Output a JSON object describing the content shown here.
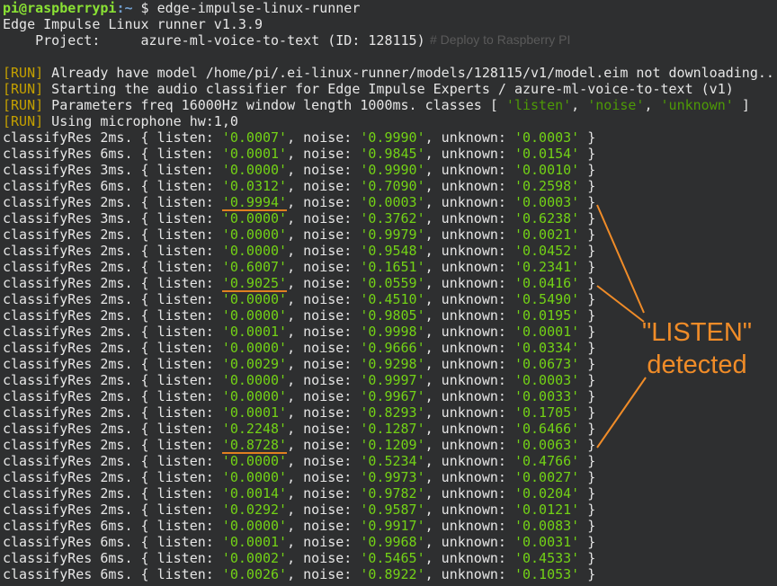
{
  "background_color": "#2e2f30",
  "accent_color": "#f08c28",
  "prompt": {
    "user_host": "pi@raspberrypi",
    "path": ":~",
    "symbol": " $ ",
    "command": "edge-impulse-linux-runner"
  },
  "header_lines": [
    "Edge Impulse Linux runner v1.3.9",
    "    Project:     azure-ml-voice-to-text (ID: 128115)"
  ],
  "ghost_text": {
    "deploy_comment": "# Deploy to Raspberry PI"
  },
  "run_lines": [
    {
      "tag": "[RUN]",
      "text": " Already have model /home/pi/.ei-linux-runner/models/128115/v1/model.eim not downloading..."
    },
    {
      "tag": "[RUN]",
      "text": " Starting the audio classifier for Edge Impulse Experts / azure-ml-voice-to-text (v1)"
    },
    {
      "tag": "[RUN]",
      "text": " Using microphone hw:1,0"
    }
  ],
  "params_line": {
    "tag": "[RUN]",
    "prefix": " Parameters freq 16000Hz window length 1000ms. classes [ ",
    "classes": [
      "'listen'",
      "'noise'",
      "'unknown'"
    ],
    "suffix": " ]"
  },
  "results": [
    {
      "ms": "2ms.",
      "listen": "'0.0007'",
      "noise": "'0.9990'",
      "unknown": "'0.0003'"
    },
    {
      "ms": "6ms.",
      "listen": "'0.0001'",
      "noise": "'0.9845'",
      "unknown": "'0.0154'"
    },
    {
      "ms": "3ms.",
      "listen": "'0.0000'",
      "noise": "'0.9990'",
      "unknown": "'0.0010'"
    },
    {
      "ms": "6ms.",
      "listen": "'0.0312'",
      "noise": "'0.7090'",
      "unknown": "'0.2598'"
    },
    {
      "ms": "2ms.",
      "listen": "'0.9994'",
      "noise": "'0.0003'",
      "unknown": "'0.0003'",
      "highlight": true
    },
    {
      "ms": "3ms.",
      "listen": "'0.0000'",
      "noise": "'0.3762'",
      "unknown": "'0.6238'"
    },
    {
      "ms": "2ms.",
      "listen": "'0.0000'",
      "noise": "'0.9979'",
      "unknown": "'0.0021'"
    },
    {
      "ms": "2ms.",
      "listen": "'0.0000'",
      "noise": "'0.9548'",
      "unknown": "'0.0452'"
    },
    {
      "ms": "2ms.",
      "listen": "'0.6007'",
      "noise": "'0.1651'",
      "unknown": "'0.2341'"
    },
    {
      "ms": "2ms.",
      "listen": "'0.9025'",
      "noise": "'0.0559'",
      "unknown": "'0.0416'",
      "highlight": true
    },
    {
      "ms": "2ms.",
      "listen": "'0.0000'",
      "noise": "'0.4510'",
      "unknown": "'0.5490'"
    },
    {
      "ms": "2ms.",
      "listen": "'0.0000'",
      "noise": "'0.9805'",
      "unknown": "'0.0195'"
    },
    {
      "ms": "2ms.",
      "listen": "'0.0001'",
      "noise": "'0.9998'",
      "unknown": "'0.0001'"
    },
    {
      "ms": "2ms.",
      "listen": "'0.0000'",
      "noise": "'0.9666'",
      "unknown": "'0.0334'"
    },
    {
      "ms": "2ms.",
      "listen": "'0.0029'",
      "noise": "'0.9298'",
      "unknown": "'0.0673'"
    },
    {
      "ms": "2ms.",
      "listen": "'0.0000'",
      "noise": "'0.9997'",
      "unknown": "'0.0003'"
    },
    {
      "ms": "2ms.",
      "listen": "'0.0000'",
      "noise": "'0.9967'",
      "unknown": "'0.0033'"
    },
    {
      "ms": "2ms.",
      "listen": "'0.0001'",
      "noise": "'0.8293'",
      "unknown": "'0.1705'"
    },
    {
      "ms": "2ms.",
      "listen": "'0.2248'",
      "noise": "'0.1287'",
      "unknown": "'0.6466'"
    },
    {
      "ms": "2ms.",
      "listen": "'0.8728'",
      "noise": "'0.1209'",
      "unknown": "'0.0063'",
      "highlight": true
    },
    {
      "ms": "2ms.",
      "listen": "'0.0000'",
      "noise": "'0.5234'",
      "unknown": "'0.4766'"
    },
    {
      "ms": "2ms.",
      "listen": "'0.0000'",
      "noise": "'0.9973'",
      "unknown": "'0.0027'"
    },
    {
      "ms": "2ms.",
      "listen": "'0.0014'",
      "noise": "'0.9782'",
      "unknown": "'0.0204'"
    },
    {
      "ms": "2ms.",
      "listen": "'0.0292'",
      "noise": "'0.9587'",
      "unknown": "'0.0121'"
    },
    {
      "ms": "6ms.",
      "listen": "'0.0000'",
      "noise": "'0.9917'",
      "unknown": "'0.0083'"
    },
    {
      "ms": "6ms.",
      "listen": "'0.0001'",
      "noise": "'0.9968'",
      "unknown": "'0.0031'"
    },
    {
      "ms": "6ms.",
      "listen": "'0.0002'",
      "noise": "'0.5465'",
      "unknown": "'0.4533'"
    },
    {
      "ms": "6ms.",
      "listen": "'0.0026'",
      "noise": "'0.8922'",
      "unknown": "'0.1053'"
    }
  ],
  "labels": {
    "classify": "classifyRes ",
    "listen": " { listen: ",
    "noise": ", noise: ",
    "unknown": ", unknown: ",
    "close": " }"
  },
  "callout": {
    "line1": "\"LISTEN\"",
    "line2": "detected"
  }
}
